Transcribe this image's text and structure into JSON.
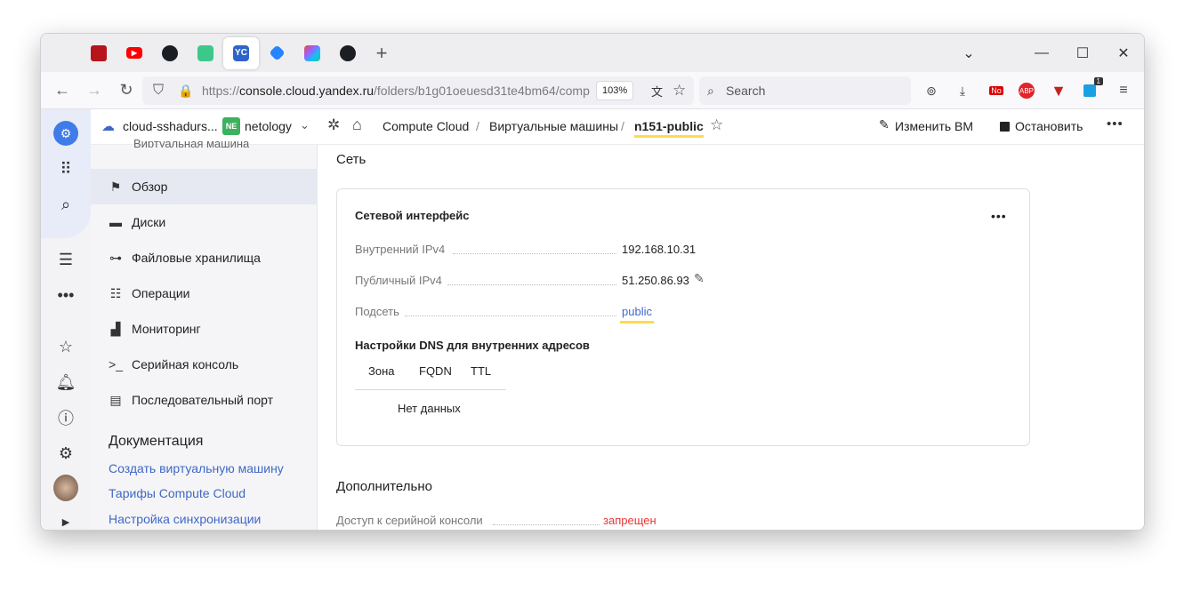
{
  "browser": {
    "url": "https://console.cloud.yandex.ru/folders/b1g01oeuesd31te4bm64/comp",
    "url_domain": "console.cloud.yandex.ru",
    "url_prefix": "https://",
    "url_suffix": "/folders/b1g01oeuesd31te4bm64/comp",
    "zoom": "103%",
    "search_placeholder": "Search",
    "new_tab": "+",
    "tabs": [
      "screen-recorder",
      "youtube",
      "github",
      "ai-app",
      "yandex-cloud",
      "jira",
      "figma",
      "github"
    ],
    "active_tab_label": "YC",
    "ext_badge_no": "No",
    "ext_badge_abp": "ABP",
    "ext_badge_count": "1"
  },
  "topbar": {
    "cloud": "cloud-sshadurs...",
    "folder_badge": "NE",
    "folder": "netology",
    "crumbs": [
      "Compute Cloud",
      "Виртуальные машины",
      "n151-public"
    ],
    "edit_vm": "Изменить ВМ",
    "stop": "Остановить"
  },
  "menu": {
    "cut_label": "Виртуальная машина",
    "items": [
      {
        "label": "Обзор",
        "icon": "flag-icon"
      },
      {
        "label": "Диски",
        "icon": "disk-icon"
      },
      {
        "label": "Файловые хранилища",
        "icon": "storage-icon"
      },
      {
        "label": "Операции",
        "icon": "list-icon"
      },
      {
        "label": "Мониторинг",
        "icon": "chart-icon"
      },
      {
        "label": "Серийная консоль",
        "icon": "terminal-icon"
      },
      {
        "label": "Последовательный порт",
        "icon": "document-icon"
      }
    ],
    "docs_title": "Документация",
    "docs_links": [
      "Создать виртуальную машину",
      "Тарифы Compute Cloud",
      "Настройка синхронизации"
    ]
  },
  "main": {
    "network_title": "Сеть",
    "iface_title": "Сетевой интерфейс",
    "fields": [
      {
        "label": "Внутренний IPv4",
        "value": "192.168.10.31"
      },
      {
        "label": "Публичный IPv4",
        "value": "51.250.86.93"
      },
      {
        "label": "Подсеть",
        "value": "public"
      }
    ],
    "dns_title": "Настройки DNS для внутренних адресов",
    "dns_cols": [
      "Зона",
      "FQDN",
      "TTL"
    ],
    "no_data": "Нет данных",
    "extra_title": "Дополнительно",
    "serial_label": "Доступ к серийной консоли",
    "serial_value": "запрещен"
  },
  "colors": {
    "accent": "#3f68c5",
    "danger": "#e53935",
    "highlight": "#ffdb4d",
    "cloud_blue": "#2d64c8"
  }
}
